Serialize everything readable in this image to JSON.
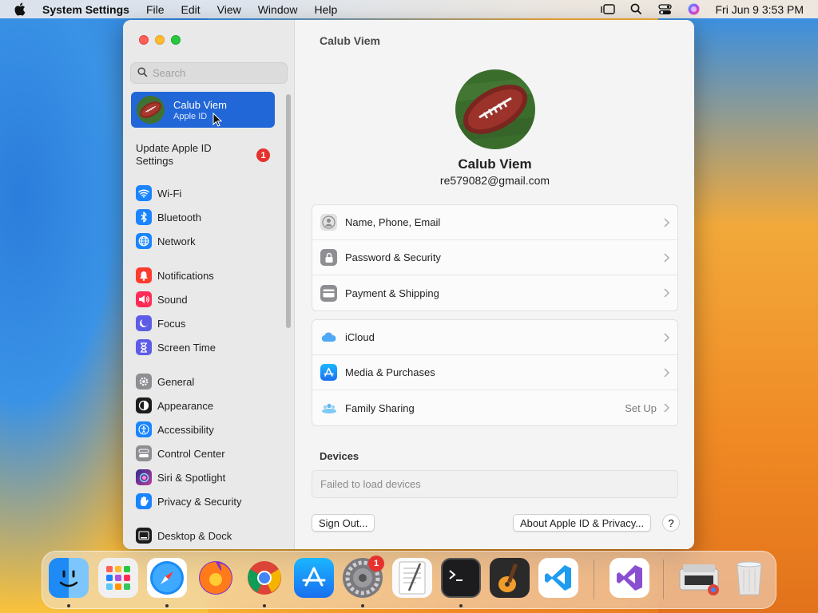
{
  "menubar": {
    "app_name": "System Settings",
    "menus": [
      "File",
      "Edit",
      "View",
      "Window",
      "Help"
    ],
    "clock": "Fri Jun 9  3:53 PM"
  },
  "sidebar": {
    "search_placeholder": "Search",
    "profile": {
      "name": "Calub Viem",
      "subtitle": "Apple ID"
    },
    "update": {
      "label": "Update Apple ID Settings",
      "badge": "1"
    },
    "groups": [
      [
        {
          "label": "Wi-Fi",
          "icon": "wifi-icon",
          "color": "#1a84ff"
        },
        {
          "label": "Bluetooth",
          "icon": "bluetooth-icon",
          "color": "#1a84ff"
        },
        {
          "label": "Network",
          "icon": "globe-icon",
          "color": "#1a84ff"
        }
      ],
      [
        {
          "label": "Notifications",
          "icon": "bell-icon",
          "color": "#ff3b30"
        },
        {
          "label": "Sound",
          "icon": "speaker-icon",
          "color": "#ff2d55"
        },
        {
          "label": "Focus",
          "icon": "moon-icon",
          "color": "#5e5ce6"
        },
        {
          "label": "Screen Time",
          "icon": "hourglass-icon",
          "color": "#5e5ce6"
        }
      ],
      [
        {
          "label": "General",
          "icon": "gear-icon",
          "color": "#8e8e93"
        },
        {
          "label": "Appearance",
          "icon": "appearance-icon",
          "color": "#1c1c1e"
        },
        {
          "label": "Accessibility",
          "icon": "accessibility-icon",
          "color": "#1a84ff"
        },
        {
          "label": "Control Center",
          "icon": "control-center-icon",
          "color": "#8e8e93"
        },
        {
          "label": "Siri & Spotlight",
          "icon": "siri-icon",
          "color": "#6b3fd1"
        },
        {
          "label": "Privacy & Security",
          "icon": "hand-icon",
          "color": "#1a84ff"
        }
      ],
      [
        {
          "label": "Desktop & Dock",
          "icon": "dock-icon",
          "color": "#1c1c1e"
        }
      ]
    ]
  },
  "main": {
    "title": "Calub Viem",
    "name": "Calub Viem",
    "email": "re579082@gmail.com",
    "card1": [
      {
        "label": "Name, Phone, Email",
        "value": ""
      },
      {
        "label": "Password & Security",
        "value": ""
      },
      {
        "label": "Payment & Shipping",
        "value": ""
      }
    ],
    "card2": [
      {
        "label": "iCloud",
        "value": ""
      },
      {
        "label": "Media & Purchases",
        "value": ""
      },
      {
        "label": "Family Sharing",
        "value": "Set Up"
      }
    ],
    "devices_title": "Devices",
    "devices_status": "Failed to load devices",
    "sign_out": "Sign Out...",
    "about": "About Apple ID & Privacy...",
    "help": "?"
  },
  "dock": {
    "settings_badge": "1"
  }
}
